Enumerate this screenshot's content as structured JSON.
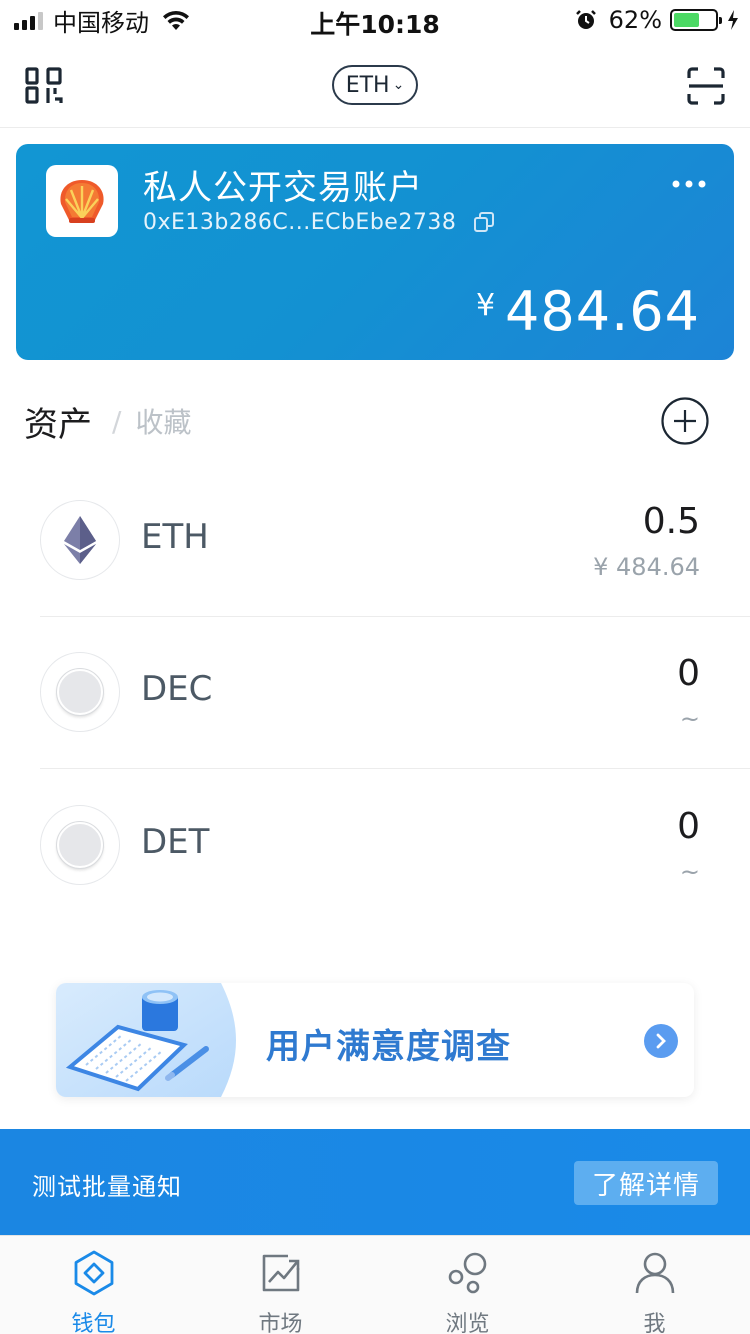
{
  "status_bar": {
    "carrier": "中国移动",
    "time": "上午10:18",
    "battery_percent": "62%",
    "battery_level": 0.62
  },
  "nav": {
    "network": "ETH",
    "left_icon": "qr-code-icon",
    "right_icon": "scan-icon"
  },
  "wallet_card": {
    "name": "私人公开交易账户",
    "address": "0xE13b286C...ECbEbe2738",
    "currency_symbol": "¥",
    "balance": "484.64",
    "gradient": [
      "#1296d3",
      "#1d84d6"
    ]
  },
  "asset_tabs": {
    "active": "资产",
    "separator": "/",
    "inactive": "收藏"
  },
  "tokens": [
    {
      "symbol": "ETH",
      "amount": "0.5",
      "value": "¥ 484.64",
      "icon": "ethereum-icon"
    },
    {
      "symbol": "DEC",
      "amount": "0",
      "value": "~",
      "icon": "token-placeholder-icon"
    },
    {
      "symbol": "DET",
      "amount": "0",
      "value": "~",
      "icon": "token-placeholder-icon"
    }
  ],
  "survey": {
    "title": "用户满意度调查"
  },
  "notice": {
    "text": "测试批量通知",
    "button": "了解详情"
  },
  "tabbar": {
    "items": [
      {
        "label": "钱包",
        "icon": "wallet-icon",
        "active": true
      },
      {
        "label": "市场",
        "icon": "market-chart-icon",
        "active": false
      },
      {
        "label": "浏览",
        "icon": "browse-bubbles-icon",
        "active": false
      },
      {
        "label": "我",
        "icon": "profile-icon",
        "active": false
      }
    ]
  },
  "colors": {
    "accent": "#1a8ae8",
    "card": "#1391d2",
    "survey_text": "#2f7ad0",
    "notice_bg": "#1b86e2"
  }
}
